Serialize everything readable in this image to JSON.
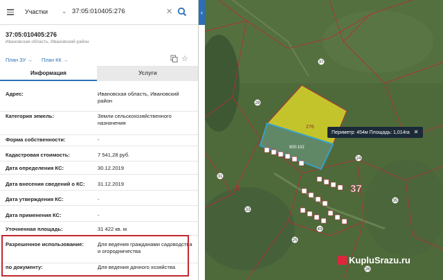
{
  "search": {
    "layer": "Участки",
    "query": "37:05:010405:276"
  },
  "parcel": {
    "number": "37:05:010405:276",
    "region": "Ивановская область, Ивановский район"
  },
  "links": {
    "plan_zu": "План ЗУ",
    "plan_kk": "План КК"
  },
  "tabs": {
    "info": "Информация",
    "services": "Услуги"
  },
  "rows": [
    {
      "label": "Адрес:",
      "value": "Ивановская область, Ивановский район"
    },
    {
      "label": "Категория земель:",
      "value": "Земли сельскохозяйственного назначения"
    },
    {
      "label": "Форма собственности:",
      "value": "-"
    },
    {
      "label": "Кадастровая стоимость:",
      "value": "7 541,28 руб."
    },
    {
      "label": "Дата определения КС:",
      "value": "30.12.2019"
    },
    {
      "label": "Дата внесения сведений о КС:",
      "value": "31.12.2019"
    },
    {
      "label": "Дата утверждения КС:",
      "value": "-"
    },
    {
      "label": "Дата применения КС:",
      "value": "-"
    },
    {
      "label": "Уточненная площадь:",
      "value": "31 422 кв. м"
    },
    {
      "label": "Разрешенное использование:",
      "value": "Для ведения гражданами садоводства и огородничества"
    },
    {
      "label": "по документу:",
      "value": "Для ведения дачного хозяйства"
    }
  ],
  "map": {
    "measurement": "Периметр: 454м Площадь: 1,014га",
    "labels": {
      "yellow_parcel": "276",
      "blue_parcel": "900:102",
      "quarter": "37",
      "quarter_5": "5",
      "n37": "37",
      "n29": "29",
      "n24": "24",
      "n31": "31",
      "n35": "35",
      "n33": "33",
      "n43": "43",
      "n25": "25",
      "n26": "26"
    }
  },
  "watermark": "KupluSrazu.ru",
  "colors": {
    "accent": "#2c6fb8",
    "highlight": "#c1272d",
    "parcel_yellow": "#d7d32a",
    "parcel_blue": "#3aa0c8",
    "boundary": "#b0303a"
  }
}
